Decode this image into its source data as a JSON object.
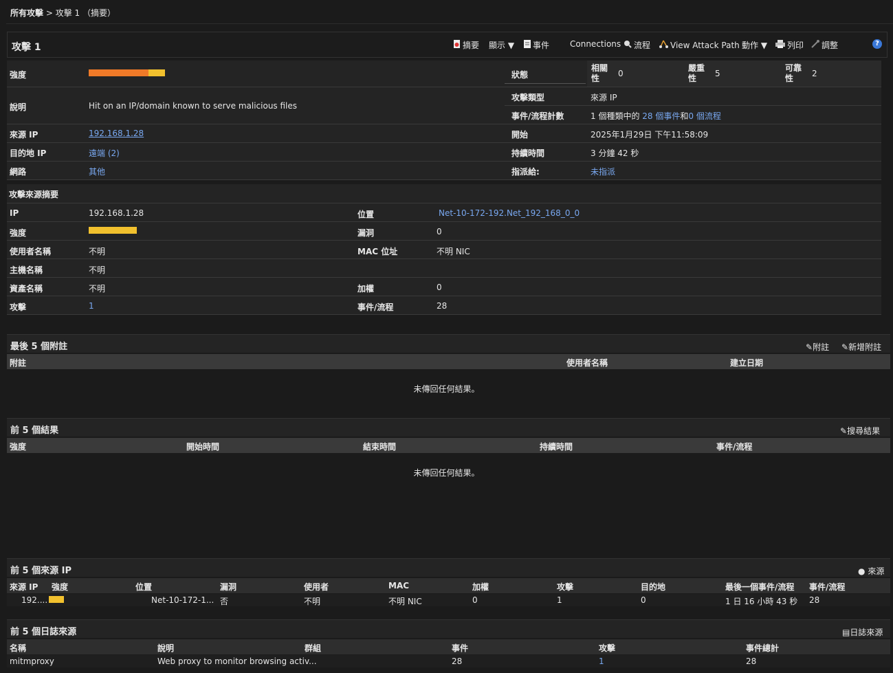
{
  "breadcrumb": {
    "root": "所有攻擊",
    "sep": " > ",
    "current": "攻擊 1 （摘要）"
  },
  "header": {
    "title": "攻擊 1",
    "toolbar": {
      "summary": "摘要",
      "display": "顯示 ▼",
      "events": "事件",
      "connections": "Connections",
      "flows": "流程",
      "attack_path": "View Attack Path",
      "actions": "動作 ▼",
      "print": "列印",
      "tune": "調整",
      "help": "?"
    }
  },
  "overview": {
    "magnitude_label": "強度",
    "status_label": "狀態",
    "relevance_label": "相關性",
    "relevance": "0",
    "severity_label": "嚴重性",
    "severity": "5",
    "credibility_label": "可靠性",
    "credibility": "2",
    "description_label": "說明",
    "description": "Hit on an IP/domain known to serve malicious files",
    "offense_type_label": "攻擊類型",
    "offense_type": "來源 IP",
    "event_flow_count_label": "事件/流程計數",
    "efc_prefix": "1 個種類中的 ",
    "efc_events": "28 個事件",
    "efc_and": "和",
    "efc_flows": "0 個流程",
    "source_ip_label": "來源 IP",
    "source_ip": "192.168.1.28",
    "start_label": "開始",
    "start": "2025年1月29日 下午11:58:09",
    "dest_ip_label": "目的地 IP",
    "dest_ip": "遠端 (2)",
    "duration_label": "持續時間",
    "duration": "3 分鐘 42 秒",
    "network_label": "網路",
    "network": "其他",
    "assigned_label": "指派給:",
    "assigned": "未指派",
    "magnitude_level": {
      "red": 0.78,
      "yellow": 0.22
    }
  },
  "source_summary": {
    "title": "攻擊來源摘要",
    "ip_label": "IP",
    "ip": "192.168.1.28",
    "location_label": "位置",
    "location": "Net-10-172-192.Net_192_168_0_0",
    "magnitude_label": "強度",
    "vuln_label": "漏洞",
    "vuln": "0",
    "user_label": "使用者名稱",
    "user": "不明",
    "mac_label": "MAC 位址",
    "mac": "不明 NIC",
    "host_label": "主機名稱",
    "host": "不明",
    "asset_label": "資產名稱",
    "asset": "不明",
    "weight_label": "加權",
    "weight": "0",
    "offenses_label": "攻擊",
    "offenses": "1",
    "events_flows_label": "事件/流程",
    "events_flows": "28"
  },
  "notes": {
    "title": "最後 5 個附註",
    "add_note": "附註",
    "new_note": "新增附註",
    "columns": [
      "附註",
      "使用者名稱",
      "建立日期"
    ],
    "empty": "未傳回任何結果。"
  },
  "results": {
    "title": "前 5 個結果",
    "search": "搜尋結果",
    "columns": [
      "強度",
      "開始時間",
      "結束時間",
      "持續時間",
      "事件/流程"
    ],
    "empty": "未傳回任何結果。"
  },
  "source_ips": {
    "title": "前 5 個來源 IP",
    "sources_link": "來源",
    "columns": [
      "來源 IP",
      "強度",
      "位置",
      "漏洞",
      "使用者",
      "MAC",
      "加權",
      "攻擊",
      "目的地",
      "最後一個事件/流程",
      "事件/流程"
    ],
    "row": {
      "ip": "192....",
      "location": "Net-10-172-1...",
      "vuln": "否",
      "user": "不明",
      "mac": "不明 NIC",
      "weight": "0",
      "offenses": "1",
      "dest": "0",
      "last": "1 日 16 小時 43 秒",
      "ef": "28"
    }
  },
  "log_sources": {
    "title": "前 5 個日誌來源",
    "link": "日誌來源",
    "columns": [
      "名稱",
      "說明",
      "群組",
      "事件",
      "攻擊",
      "事件總計"
    ],
    "row": {
      "name": "mitmproxy",
      "desc": "Web proxy to monitor browsing activ...",
      "group": "",
      "events": "28",
      "offenses": "1",
      "total": "28"
    }
  },
  "colors": {
    "bg": "#1b1b1b",
    "panel": "#242424",
    "link": "#79a8f0",
    "mag_red": "#f07a28",
    "mag_yellow": "#f2c12e"
  }
}
